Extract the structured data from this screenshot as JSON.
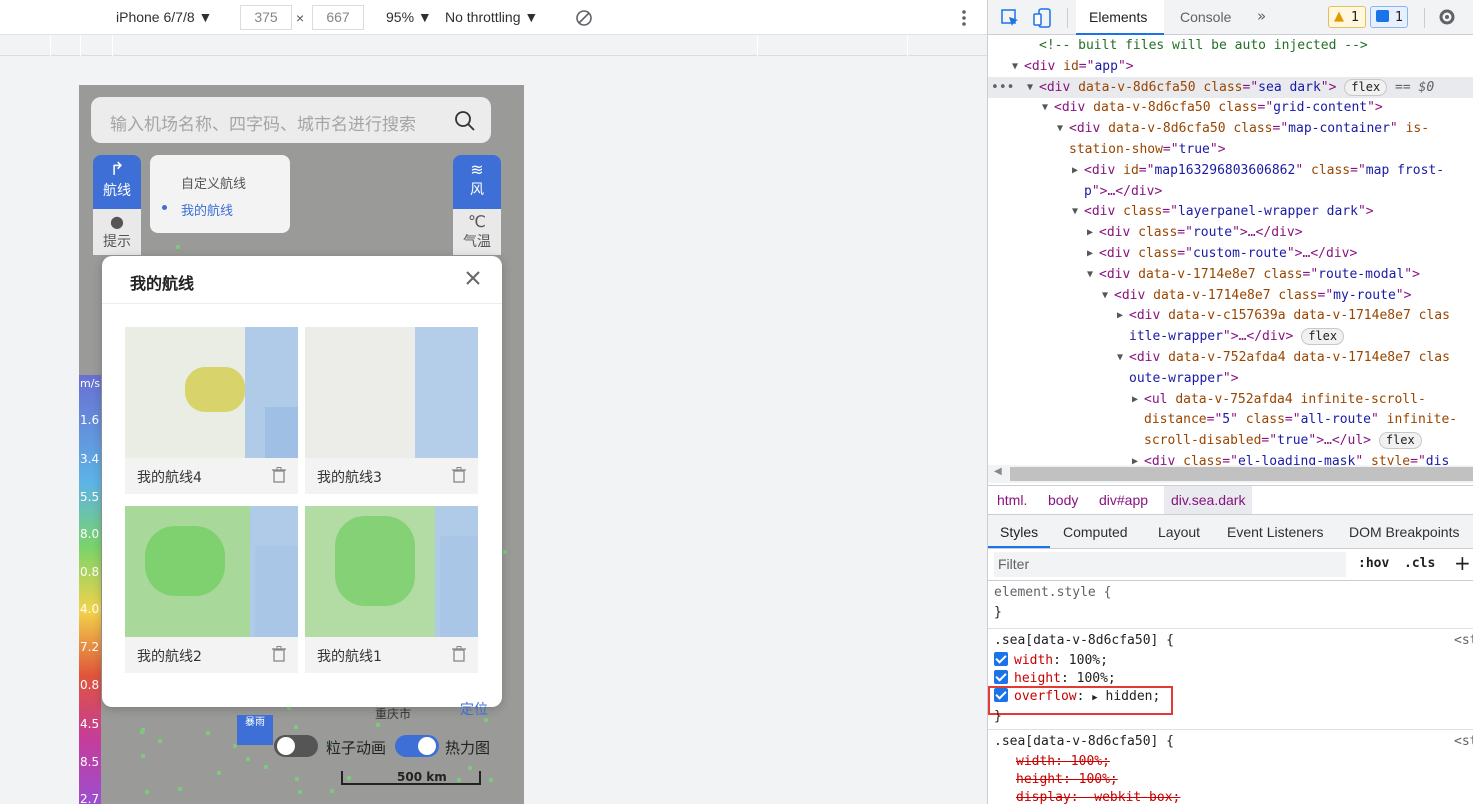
{
  "device_toolbar": {
    "device": "iPhone 6/7/8",
    "width": "375",
    "times": "×",
    "height": "667",
    "zoom": "95%",
    "throttle": "No throttling",
    "icons": [
      "chevron-down-icon",
      "rotate-icon",
      "more-vert-icon"
    ]
  },
  "app": {
    "search_placeholder": "输入机场名称、四字码、城市名进行搜索",
    "left_buttons": [
      {
        "label": "航线"
      },
      {
        "label": "提示"
      }
    ],
    "right_buttons": [
      {
        "label": "风"
      },
      {
        "label": "气温"
      }
    ],
    "route_menu": {
      "items": [
        "自定义航线",
        "我的航线"
      ],
      "active_index": 1
    },
    "legend": {
      "unit": "m/s",
      "values": [
        "1.6",
        "3.4",
        "5.5",
        "8.0",
        "0.8",
        "4.0",
        "7.2",
        "0.8",
        "4.5",
        "8.5",
        "2.7"
      ]
    },
    "modal": {
      "title": "我的航线",
      "routes": [
        {
          "name": "我的航线4"
        },
        {
          "name": "我的航线3"
        },
        {
          "name": "我的航线2"
        },
        {
          "name": "我的航线1"
        }
      ]
    },
    "map_labels": {
      "city": "重庆市",
      "locate": "定位",
      "scale": "500 km",
      "weather_badge": "暴雨"
    },
    "toggles": [
      {
        "label": "粒子动画",
        "on": false
      },
      {
        "label": "热力图",
        "on": true
      }
    ]
  },
  "devtools": {
    "tabs": [
      "Elements",
      "Console"
    ],
    "active_tab": "Elements",
    "warn_count": "1",
    "msg_count": "1",
    "dom_lines": [
      {
        "indent": 3,
        "arrow": "",
        "parts": [
          [
            "cm",
            "<!-- built files will be auto injected -->"
          ]
        ]
      },
      {
        "indent": 2,
        "arrow": "▼",
        "parts": [
          [
            "tag",
            "<div "
          ],
          [
            "an",
            "id"
          ],
          [
            "tag",
            "=\""
          ],
          [
            "av",
            "app"
          ],
          [
            "tag",
            "\">"
          ]
        ]
      },
      {
        "indent": 3,
        "arrow": "▼",
        "selected": true,
        "parts": [
          [
            "tag",
            "<div "
          ],
          [
            "an",
            "data-v-8d6cfa50 class"
          ],
          [
            "tag",
            "=\""
          ],
          [
            "av",
            "sea dark"
          ],
          [
            "tag",
            "\">"
          ]
        ],
        "pill": "flex",
        "suffix": " == $0"
      },
      {
        "indent": 4,
        "arrow": "▼",
        "parts": [
          [
            "tag",
            "<div "
          ],
          [
            "an",
            "data-v-8d6cfa50 class"
          ],
          [
            "tag",
            "=\""
          ],
          [
            "av",
            "grid-content"
          ],
          [
            "tag",
            "\">"
          ]
        ]
      },
      {
        "indent": 5,
        "arrow": "▼",
        "parts": [
          [
            "tag",
            "<div "
          ],
          [
            "an",
            "data-v-8d6cfa50 class"
          ],
          [
            "tag",
            "=\""
          ],
          [
            "av",
            "map-container"
          ],
          [
            "tag",
            "\" "
          ],
          [
            "an",
            "is-"
          ]
        ]
      },
      {
        "indent": 5,
        "arrow": "",
        "parts": [
          [
            "an",
            "station-show"
          ],
          [
            "tag",
            "=\""
          ],
          [
            "av",
            "true"
          ],
          [
            "tag",
            "\">"
          ]
        ]
      },
      {
        "indent": 6,
        "arrow": "▶",
        "parts": [
          [
            "tag",
            "<div "
          ],
          [
            "an",
            "id"
          ],
          [
            "tag",
            "=\""
          ],
          [
            "av",
            "map163296803606862"
          ],
          [
            "tag",
            "\" "
          ],
          [
            "an",
            "class"
          ],
          [
            "tag",
            "=\""
          ],
          [
            "av",
            "map frost-"
          ]
        ]
      },
      {
        "indent": 6,
        "arrow": "",
        "parts": [
          [
            "av",
            "p"
          ],
          [
            "tag",
            "\">…</div>"
          ]
        ]
      },
      {
        "indent": 6,
        "arrow": "▼",
        "parts": [
          [
            "tag",
            "<div "
          ],
          [
            "an",
            "class"
          ],
          [
            "tag",
            "=\""
          ],
          [
            "av",
            "layerpanel-wrapper dark"
          ],
          [
            "tag",
            "\">"
          ]
        ]
      },
      {
        "indent": 7,
        "arrow": "▶",
        "parts": [
          [
            "tag",
            "<div "
          ],
          [
            "an",
            "class"
          ],
          [
            "tag",
            "=\""
          ],
          [
            "av",
            "route"
          ],
          [
            "tag",
            "\">…</div>"
          ]
        ]
      },
      {
        "indent": 7,
        "arrow": "▶",
        "parts": [
          [
            "tag",
            "<div "
          ],
          [
            "an",
            "class"
          ],
          [
            "tag",
            "=\""
          ],
          [
            "av",
            "custom-route"
          ],
          [
            "tag",
            "\">…</div>"
          ]
        ]
      },
      {
        "indent": 7,
        "arrow": "▼",
        "parts": [
          [
            "tag",
            "<div "
          ],
          [
            "an",
            "data-v-1714e8e7 class"
          ],
          [
            "tag",
            "=\""
          ],
          [
            "av",
            "route-modal"
          ],
          [
            "tag",
            "\">"
          ]
        ]
      },
      {
        "indent": 8,
        "arrow": "▼",
        "parts": [
          [
            "tag",
            "<div "
          ],
          [
            "an",
            "data-v-1714e8e7 class"
          ],
          [
            "tag",
            "=\""
          ],
          [
            "av",
            "my-route"
          ],
          [
            "tag",
            "\">"
          ]
        ]
      },
      {
        "indent": 9,
        "arrow": "▶",
        "parts": [
          [
            "tag",
            "<div "
          ],
          [
            "an",
            "data-v-c157639a data-v-1714e8e7 clas"
          ]
        ]
      },
      {
        "indent": 9,
        "arrow": "",
        "parts": [
          [
            "av",
            "itle-wrapper"
          ],
          [
            "tag",
            "\">…</div>"
          ]
        ],
        "pill": "flex"
      },
      {
        "indent": 9,
        "arrow": "▼",
        "parts": [
          [
            "tag",
            "<div "
          ],
          [
            "an",
            "data-v-752afda4 data-v-1714e8e7 clas"
          ]
        ]
      },
      {
        "indent": 9,
        "arrow": "",
        "parts": [
          [
            "av",
            "oute-wrapper"
          ],
          [
            "tag",
            "\">"
          ]
        ]
      },
      {
        "indent": 10,
        "arrow": "▶",
        "parts": [
          [
            "tag",
            "<ul "
          ],
          [
            "an",
            "data-v-752afda4 infinite-scroll-"
          ]
        ]
      },
      {
        "indent": 10,
        "arrow": "",
        "parts": [
          [
            "an",
            "distance"
          ],
          [
            "tag",
            "=\""
          ],
          [
            "av",
            "5"
          ],
          [
            "tag",
            "\" "
          ],
          [
            "an",
            "class"
          ],
          [
            "tag",
            "=\""
          ],
          [
            "av",
            "all-route"
          ],
          [
            "tag",
            "\" "
          ],
          [
            "an",
            "infinite-"
          ]
        ]
      },
      {
        "indent": 10,
        "arrow": "",
        "parts": [
          [
            "an",
            "scroll-disabled"
          ],
          [
            "tag",
            "=\""
          ],
          [
            "av",
            "true"
          ],
          [
            "tag",
            "\">…</ul>"
          ]
        ],
        "pill": "flex"
      },
      {
        "indent": 10,
        "arrow": "▶",
        "parts": [
          [
            "tag",
            "<div "
          ],
          [
            "an",
            "class"
          ],
          [
            "tag",
            "=\""
          ],
          [
            "av",
            "el-loading-mask"
          ],
          [
            "tag",
            "\" "
          ],
          [
            "an",
            "style"
          ],
          [
            "tag",
            "=\""
          ],
          [
            "av",
            "dis"
          ]
        ]
      }
    ],
    "breadcrumb": [
      "html.",
      "body",
      "div#app",
      "div.sea.dark"
    ],
    "style_tabs": [
      "Styles",
      "Computed",
      "Layout",
      "Event Listeners",
      "DOM Breakpoints"
    ],
    "filter_placeholder": "Filter",
    "hov": ":hov",
    "cls": ".cls",
    "plus": "+",
    "rules": {
      "element_style": "element.style {",
      "close": "}",
      "sel1": ".sea[data-v-8d6cfa50] {",
      "src": "<st",
      "p1": "width",
      "v1": "100%;",
      "p2": "height",
      "v2": "100%;",
      "p3": "overflow",
      "v3": "hidden;",
      "sel2": ".sea[data-v-8d6cfa50] {",
      "s1": "width: 100%;",
      "s2": "height: 100%;",
      "s3": "display: -webkit-box;"
    }
  }
}
